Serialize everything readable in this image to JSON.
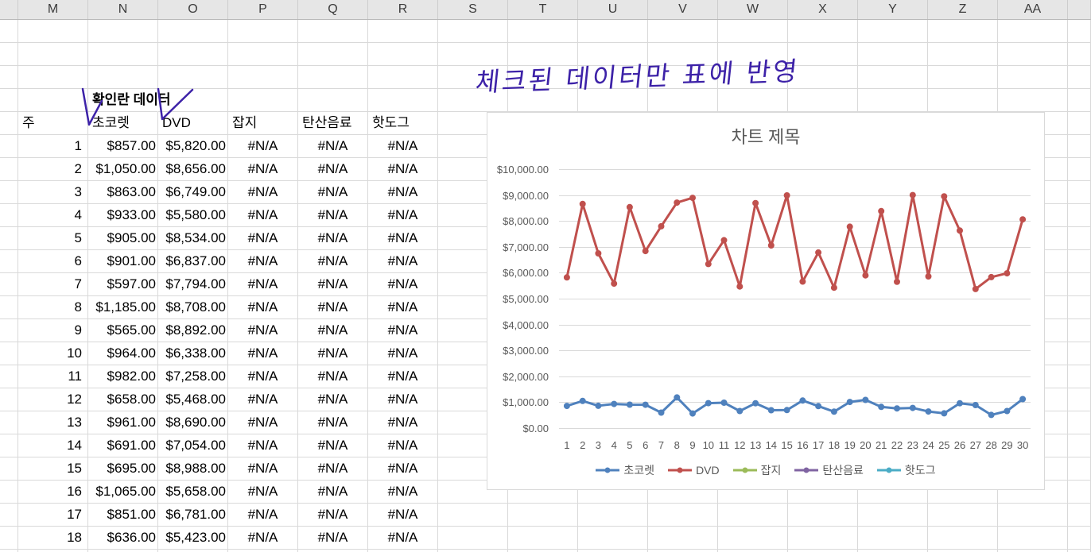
{
  "sheet": {
    "column_headers": [
      "M",
      "N",
      "O",
      "P",
      "Q",
      "R",
      "S",
      "T",
      "U",
      "V",
      "W",
      "X",
      "Y",
      "Z",
      "AA"
    ],
    "title_label": "확인란 데이터",
    "header_row": [
      "주",
      "초코렛",
      "DVD",
      "잡지",
      "탄산음료",
      "핫도그"
    ],
    "rows": [
      [
        "1",
        "$857.00",
        "$5,820.00",
        "#N/A",
        "#N/A",
        "#N/A"
      ],
      [
        "2",
        "$1,050.00",
        "$8,656.00",
        "#N/A",
        "#N/A",
        "#N/A"
      ],
      [
        "3",
        "$863.00",
        "$6,749.00",
        "#N/A",
        "#N/A",
        "#N/A"
      ],
      [
        "4",
        "$933.00",
        "$5,580.00",
        "#N/A",
        "#N/A",
        "#N/A"
      ],
      [
        "5",
        "$905.00",
        "$8,534.00",
        "#N/A",
        "#N/A",
        "#N/A"
      ],
      [
        "6",
        "$901.00",
        "$6,837.00",
        "#N/A",
        "#N/A",
        "#N/A"
      ],
      [
        "7",
        "$597.00",
        "$7,794.00",
        "#N/A",
        "#N/A",
        "#N/A"
      ],
      [
        "8",
        "$1,185.00",
        "$8,708.00",
        "#N/A",
        "#N/A",
        "#N/A"
      ],
      [
        "9",
        "$565.00",
        "$8,892.00",
        "#N/A",
        "#N/A",
        "#N/A"
      ],
      [
        "10",
        "$964.00",
        "$6,338.00",
        "#N/A",
        "#N/A",
        "#N/A"
      ],
      [
        "11",
        "$982.00",
        "$7,258.00",
        "#N/A",
        "#N/A",
        "#N/A"
      ],
      [
        "12",
        "$658.00",
        "$5,468.00",
        "#N/A",
        "#N/A",
        "#N/A"
      ],
      [
        "13",
        "$961.00",
        "$8,690.00",
        "#N/A",
        "#N/A",
        "#N/A"
      ],
      [
        "14",
        "$691.00",
        "$7,054.00",
        "#N/A",
        "#N/A",
        "#N/A"
      ],
      [
        "15",
        "$695.00",
        "$8,988.00",
        "#N/A",
        "#N/A",
        "#N/A"
      ],
      [
        "16",
        "$1,065.00",
        "$5,658.00",
        "#N/A",
        "#N/A",
        "#N/A"
      ],
      [
        "17",
        "$851.00",
        "$6,781.00",
        "#N/A",
        "#N/A",
        "#N/A"
      ],
      [
        "18",
        "$636.00",
        "$5,423.00",
        "#N/A",
        "#N/A",
        "#N/A"
      ]
    ]
  },
  "annotation": {
    "handwritten_note": "체크된 데이터만 표에 반영",
    "ink_color": "#3d22a8"
  },
  "chart_data": {
    "type": "line",
    "title": "차트 제목",
    "categories": [
      "1",
      "2",
      "3",
      "4",
      "5",
      "6",
      "7",
      "8",
      "9",
      "10",
      "11",
      "12",
      "13",
      "14",
      "15",
      "16",
      "17",
      "18",
      "19",
      "20",
      "21",
      "22",
      "23",
      "24",
      "25",
      "26",
      "27",
      "28",
      "29",
      "30"
    ],
    "ylim": [
      0,
      10000
    ],
    "y_ticks": [
      0,
      1000,
      2000,
      3000,
      4000,
      5000,
      6000,
      7000,
      8000,
      9000,
      10000
    ],
    "y_tick_labels": [
      "$0.00",
      "$1,000.00",
      "$2,000.00",
      "$3,000.00",
      "$4,000.00",
      "$5,000.00",
      "$6,000.00",
      "$7,000.00",
      "$8,000.00",
      "$9,000.00",
      "$10,000.00"
    ],
    "grid": true,
    "legend": "bottom",
    "markers": true,
    "series": [
      {
        "name": "초코렛",
        "color": "#4f81bd",
        "values": [
          857,
          1050,
          863,
          933,
          905,
          901,
          597,
          1185,
          565,
          964,
          982,
          658,
          961,
          691,
          695,
          1065,
          851,
          636,
          1010,
          1090,
          820,
          760,
          780,
          640,
          570,
          960,
          890,
          510,
          660,
          1120
        ]
      },
      {
        "name": "DVD",
        "color": "#c0504d",
        "values": [
          5820,
          8656,
          6749,
          5580,
          8534,
          6837,
          7794,
          8708,
          8892,
          6338,
          7258,
          5468,
          8690,
          7054,
          8988,
          5658,
          6781,
          5423,
          7780,
          5900,
          8380,
          5650,
          9000,
          5860,
          8950,
          7630,
          5370,
          5830,
          5980,
          8060
        ]
      },
      {
        "name": "잡지",
        "color": "#9bbb59",
        "values": []
      },
      {
        "name": "탄산음료",
        "color": "#8064a2",
        "values": []
      },
      {
        "name": "핫도그",
        "color": "#4bacc6",
        "values": []
      }
    ]
  }
}
